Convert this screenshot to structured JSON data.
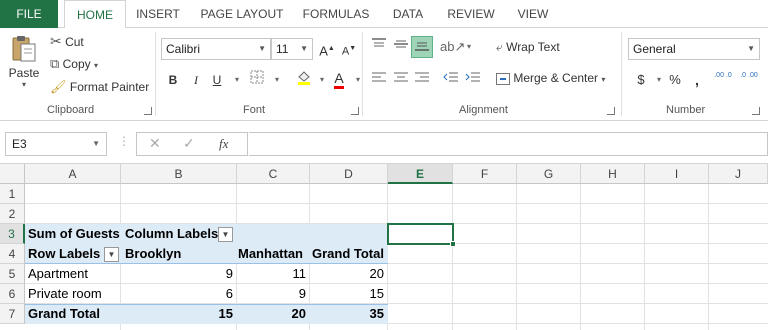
{
  "tabs": [
    {
      "label": "FILE"
    },
    {
      "label": "HOME"
    },
    {
      "label": "INSERT"
    },
    {
      "label": "PAGE LAYOUT"
    },
    {
      "label": "FORMULAS"
    },
    {
      "label": "DATA"
    },
    {
      "label": "REVIEW"
    },
    {
      "label": "VIEW"
    }
  ],
  "ribbon": {
    "clipboard": {
      "paste": "Paste",
      "cut": "Cut",
      "copy": "Copy",
      "format_painter": "Format Painter",
      "group": "Clipboard"
    },
    "font": {
      "name": "Calibri",
      "size": "11",
      "grow": "A",
      "shrink": "A",
      "bold": "B",
      "italic": "I",
      "underline": "U",
      "font_color": "A",
      "group": "Font"
    },
    "alignment": {
      "wrap_text": "Wrap Text",
      "merge_center": "Merge & Center",
      "group": "Alignment"
    },
    "number": {
      "format": "General",
      "currency": "$",
      "percent": "%",
      "comma": ",",
      "inc_decimal": ".00 .0",
      "dec_decimal": ".0 .00",
      "group": "Number"
    }
  },
  "formula_bar": {
    "name_box": "E3",
    "fx": "fx",
    "value": ""
  },
  "columns": [
    "A",
    "B",
    "C",
    "D",
    "E",
    "F",
    "G",
    "H",
    "I",
    "J"
  ],
  "rows": [
    "1",
    "2",
    "3",
    "4",
    "5",
    "6",
    "7"
  ],
  "selected_cell": "E3",
  "pivot": {
    "header": {
      "label": "Sum of Guests",
      "col_labels": "Column Labels"
    },
    "subheader": {
      "row_labels": "Row Labels",
      "col1": "Brooklyn",
      "col2": "Manhattan",
      "col3": "Grand Total"
    },
    "rows": [
      {
        "label": "Apartment",
        "b": "9",
        "c": "11",
        "d": "20"
      },
      {
        "label": "Private room",
        "b": "6",
        "c": "9",
        "d": "15"
      }
    ],
    "total": {
      "label": "Grand Total",
      "b": "15",
      "c": "20",
      "d": "35"
    }
  },
  "colors": {
    "accent": "#217346",
    "pivot_band": "#ddebf7"
  }
}
